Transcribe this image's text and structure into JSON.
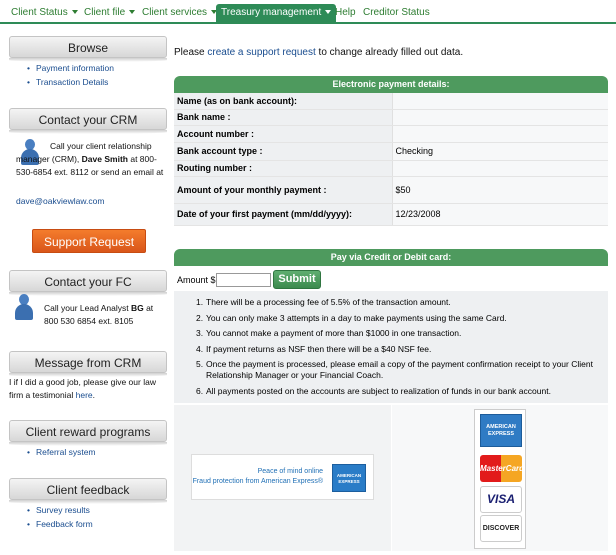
{
  "nav": {
    "items": [
      {
        "label": "Client Status",
        "dropdown": true
      },
      {
        "label": "Client file",
        "dropdown": true
      },
      {
        "label": "Client services",
        "dropdown": true
      },
      {
        "label": "Treasury management",
        "dropdown": true,
        "active": true
      },
      {
        "label": "Help",
        "dropdown": false
      },
      {
        "label": "Creditor Status",
        "dropdown": false
      }
    ]
  },
  "sidebar": {
    "browse": {
      "title": "Browse",
      "items": [
        "Payment information",
        "Transaction Details"
      ]
    },
    "crm": {
      "title": "Contact your CRM",
      "text1": "Call your client relationship manager (CRM),",
      "name": "Dave Smith",
      "text2": "at 800-530-6854 ext. 8112 or send an email at",
      "email": "dave@oakviewlaw.com"
    },
    "support_button": "Support Request",
    "fc": {
      "title": "Contact your FC",
      "text1": "Call your Lead Analyst",
      "name": "BG",
      "text2": "at 800 530 6854 ext. 8105"
    },
    "message": {
      "title": "Message from CRM",
      "text": "I if I did a good job, please give our law firm a testimonial",
      "link": "here"
    },
    "rewards": {
      "title": "Client reward programs",
      "items": [
        "Referral system"
      ]
    },
    "feedback": {
      "title": "Client feedback",
      "items": [
        "Survey results",
        "Feedback form"
      ]
    }
  },
  "main": {
    "intro_prefix": "Please",
    "intro_link": "create a support request",
    "intro_suffix": "to change already filled out data.",
    "details_title": "Electronic payment details:",
    "details": [
      {
        "label": "Name (as on bank account):",
        "value": ""
      },
      {
        "label": "Bank name :",
        "value": ""
      },
      {
        "label": "Account number :",
        "value": ""
      },
      {
        "label": "Bank account type :",
        "value": "Checking"
      },
      {
        "label": "Routing number :",
        "value": ""
      },
      {
        "label": "Amount of your monthly payment :",
        "value": "$50"
      },
      {
        "label": "Date of your first payment (mm/dd/yyyy):",
        "value": "12/23/2008"
      }
    ],
    "card_title": "Pay via Credit or Debit card:",
    "amount_label": "Amount $",
    "amount_value": "",
    "submit_label": "Submit",
    "rules": [
      "There will be a processing fee of 5.5% of the transaction amount.",
      "You can only make 3 attempts in a day to make payments using the same Card.",
      "You cannot make a payment of more than $1000 in one transaction.",
      "If payment returns as NSF then there will be a $40 NSF fee.",
      "Once the payment is processed, please email a copy of the payment confirmation receipt to your Client Relationship Manager or your Financial Coach.",
      "All payments posted on the accounts are subject to realization of funds in our bank account."
    ],
    "amex_banner": {
      "line1": "Peace of mind online",
      "line2": "Fraud protection from American Express®",
      "logo": "AMERICAN EXPRESS"
    },
    "cards": {
      "amex": "AMERICAN EXPRESS",
      "mastercard": "MasterCard",
      "visa": "VISA",
      "discover": "DISCOVER"
    }
  },
  "colors": {
    "accent_green": "#2e8b57",
    "panel_green": "#4e9a5e",
    "support_orange": "#e8651f",
    "link_blue": "#1a4d8f"
  }
}
